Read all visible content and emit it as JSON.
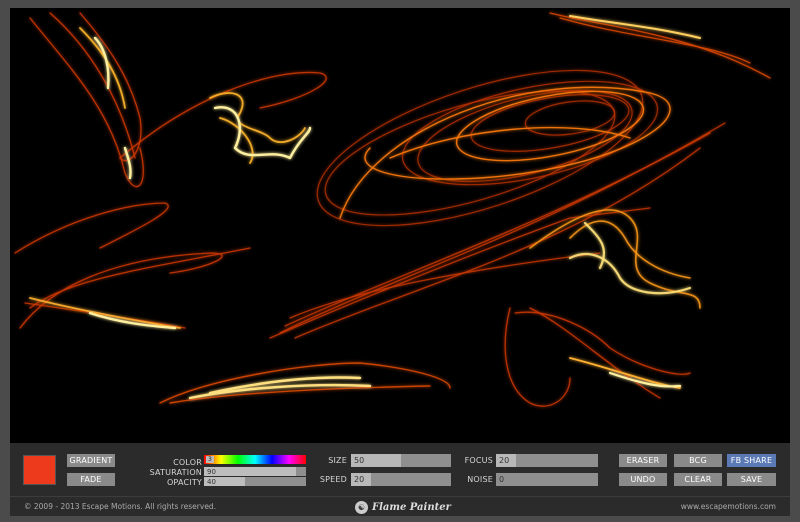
{
  "buttons": {
    "gradient": "GRADIENT",
    "fade": "FADE",
    "eraser": "ERASER",
    "bcg": "BCG",
    "fb_share": "FB SHARE",
    "undo": "UNDO",
    "clear": "CLEAR",
    "save": "SAVE"
  },
  "labels": {
    "color": "COLOR",
    "saturation": "SATURATION",
    "opacity": "OPACITY",
    "size": "SIZE",
    "speed": "SPEED",
    "focus": "FOCUS",
    "noise": "NOISE"
  },
  "values": {
    "color": "3",
    "saturation": "90",
    "opacity": "40",
    "size": "50",
    "speed": "20",
    "focus": "20",
    "noise": "0"
  },
  "levels": {
    "saturation": 0.9,
    "opacity": 0.4,
    "size": 0.5,
    "speed": 0.2,
    "focus": 0.2,
    "noise": 0.0
  },
  "colors": {
    "current_color": "#ee3a1c",
    "accent": "#5a79b5",
    "flame_core": "#ffe27a",
    "flame_mid": "#ff8a10",
    "flame_edge": "#c02a00"
  },
  "footer": {
    "copyright": "© 2009 - 2013 Escape Motions. All rights reserved.",
    "app_name": "Flame Painter",
    "website": "www.escapemotions.com"
  },
  "icons": {
    "logo": "flame-painter-logo-icon"
  }
}
